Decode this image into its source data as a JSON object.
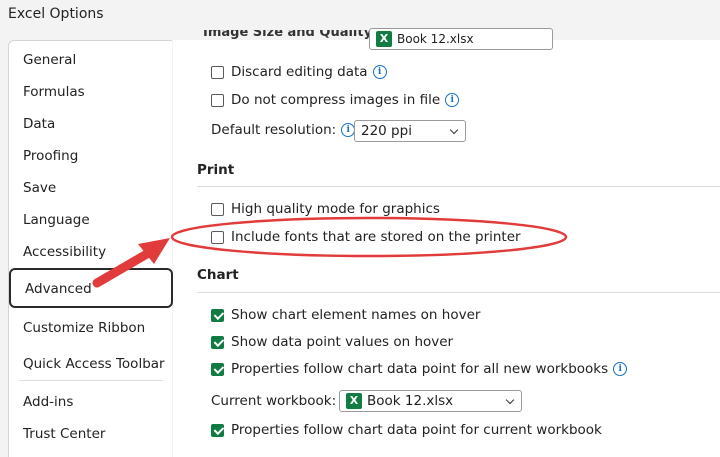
{
  "window": {
    "title": "Excel Options"
  },
  "sidebar": {
    "items": [
      {
        "label": "General"
      },
      {
        "label": "Formulas"
      },
      {
        "label": "Data"
      },
      {
        "label": "Proofing"
      },
      {
        "label": "Save"
      },
      {
        "label": "Language"
      },
      {
        "label": "Accessibility"
      },
      {
        "label": "Advanced",
        "selected": true
      },
      {
        "label": "Customize Ribbon"
      },
      {
        "label": "Quick Access Toolbar"
      },
      {
        "label": "Add-ins"
      },
      {
        "label": "Trust Center"
      }
    ]
  },
  "image_section": {
    "header_partial": "Image Size and Quality",
    "workbook_dropdown_partial": "Book 12.xlsx",
    "discard_editing": {
      "label": "Discard editing data",
      "checked": false
    },
    "no_compress": {
      "label": "Do not compress images in file",
      "checked": false
    },
    "default_resolution": {
      "label": "Default resolution:",
      "value": "220 ppi"
    }
  },
  "print_section": {
    "header": "Print",
    "high_quality": {
      "label": "High quality mode for graphics",
      "checked": false
    },
    "include_fonts": {
      "label": "Include fonts that are stored on the printer",
      "checked": false
    }
  },
  "chart_section": {
    "header": "Chart",
    "show_names": {
      "label": "Show chart element names on hover",
      "checked": true
    },
    "show_values": {
      "label": "Show data point values on hover",
      "checked": true
    },
    "props_all": {
      "label": "Properties follow chart data point for all new workbooks",
      "checked": true
    },
    "current_workbook": {
      "label": "Current workbook:",
      "value": "Book 12.xlsx"
    },
    "props_current": {
      "label": "Properties follow chart data point for current workbook",
      "checked": true
    }
  },
  "colors": {
    "accent_green": "#107c41",
    "annotation_red": "#e23b3b",
    "info_blue": "#1a6fc4"
  }
}
